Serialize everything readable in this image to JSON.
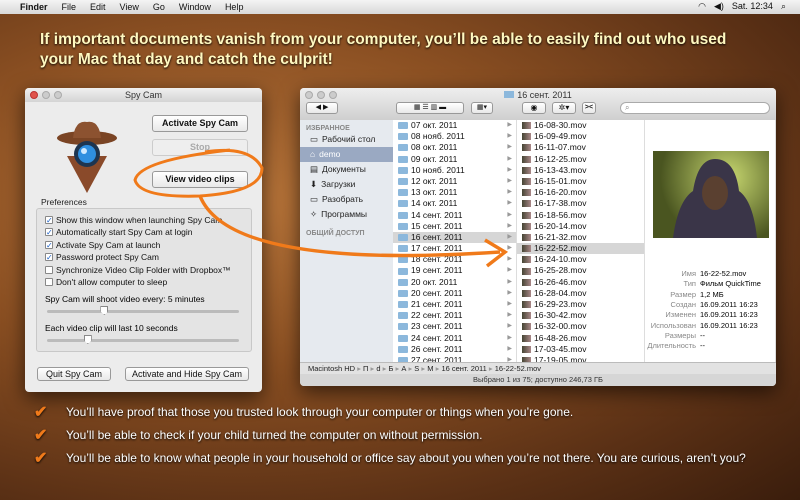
{
  "menubar": {
    "items": [
      "Finder",
      "File",
      "Edit",
      "View",
      "Go",
      "Window",
      "Help"
    ],
    "clock": "Sat. 12:34"
  },
  "headline": "If important documents vanish from your computer, you’ll be able to easily find out who used your Mac that day and catch the culprit!",
  "spycam": {
    "title": "Spy Cam",
    "activate": "Activate Spy Cam",
    "stop": "Stop",
    "view_clips": "View video clips",
    "prefs_label": "Preferences",
    "checks": [
      {
        "label": "Show this window when launching Spy Cam",
        "checked": true
      },
      {
        "label": "Automatically start Spy Cam at login",
        "checked": true
      },
      {
        "label": "Activate Spy Cam at launch",
        "checked": true
      },
      {
        "label": "Password protect Spy Cam",
        "checked": true
      },
      {
        "label": "Synchronize Video Clip Folder with Dropbox™",
        "checked": false
      },
      {
        "label": "Don't allow computer to sleep",
        "checked": false
      }
    ],
    "interval_label": "Spy Cam will shoot video every: 5 minutes",
    "interval_fraction": 0.29,
    "duration_label": "Each video clip will last 10 seconds",
    "duration_fraction": 0.2,
    "quit": "Quit Spy Cam",
    "activate_hide": "Activate and Hide Spy Cam"
  },
  "finder": {
    "title": "16 сент. 2011",
    "search_placeholder": "",
    "sidebar": {
      "favorites_header": "ИЗБРАННОЕ",
      "items": [
        "Рабочий стол",
        "demo",
        "Документы",
        "Загрузки",
        "Разобрать",
        "Программы"
      ],
      "shared_header": "ОБЩИЙ ДОСТУП"
    },
    "folders": [
      "07 окт. 2011",
      "08 нояб. 2011",
      "08 окт. 2011",
      "09 окт. 2011",
      "10 нояб. 2011",
      "12 окт. 2011",
      "13 окт. 2011",
      "14 окт. 2011",
      "14 сент. 2011",
      "15 сент. 2011",
      "16 сент. 2011",
      "17 сент. 2011",
      "18 сент. 2011",
      "19 сент. 2011",
      "20 окт. 2011",
      "20 сент. 2011",
      "21 сент. 2011",
      "22 сент. 2011",
      "23 сент. 2011",
      "24 сент. 2011",
      "26 сент. 2011",
      "27 сент. 2011"
    ],
    "files": [
      "16-08-30.mov",
      "16-09-49.mov",
      "16-11-07.mov",
      "16-12-25.mov",
      "16-13-43.mov",
      "16-15-01.mov",
      "16-16-20.mov",
      "16-17-38.mov",
      "16-18-56.mov",
      "16-20-14.mov",
      "16-21-32.mov",
      "16-22-52.mov",
      "16-24-10.mov",
      "16-25-28.mov",
      "16-26-46.mov",
      "16-28-04.mov",
      "16-29-23.mov",
      "16-30-42.mov",
      "16-32-00.mov",
      "16-48-26.mov",
      "17-03-45.mov",
      "17-19-05.mov"
    ],
    "info": [
      {
        "k": "Имя",
        "v": "16-22-52.mov"
      },
      {
        "k": "Тип",
        "v": "Фильм QuickTime"
      },
      {
        "k": "Размер",
        "v": "1,2 МБ"
      },
      {
        "k": "Создан",
        "v": "16.09.2011 16:23"
      },
      {
        "k": "Изменен",
        "v": "16.09.2011 16:23"
      },
      {
        "k": "Использован",
        "v": "16.09.2011 16:23"
      },
      {
        "k": "Размеры",
        "v": "--"
      },
      {
        "k": "Длительность",
        "v": "--"
      }
    ],
    "path": [
      "Macintosh HD",
      "П",
      "d",
      "Б",
      "А",
      "S",
      "M",
      "16 сент. 2011",
      "16-22-52.mov"
    ],
    "status": "Выбрано 1 из 75; доступно 246,73 ГБ"
  },
  "bullets": [
    "You’ll have proof that those you trusted look through your computer or things when you’re gone.",
    "You’ll be able to check if your child turned the computer on without permission.",
    "You’ll be able to know what people in your household or office say about you when you’re not there. You are curious, aren’t you?"
  ],
  "colors": {
    "accent": "#f07a1a",
    "headline": "#fff8c0"
  }
}
